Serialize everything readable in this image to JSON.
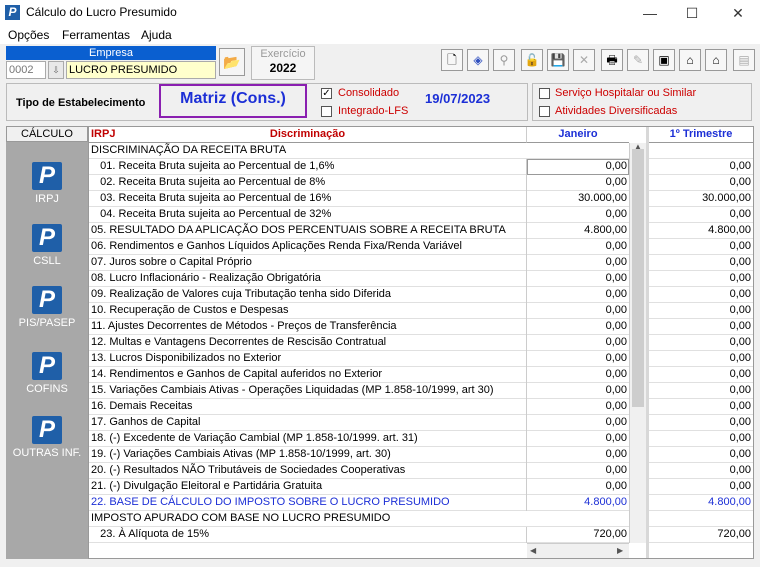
{
  "window": {
    "title": "Cálculo do Lucro Presumido",
    "minimize": "—",
    "maximize": "☐",
    "close": "✕"
  },
  "menu": [
    "Opções",
    "Ferramentas",
    "Ajuda"
  ],
  "empresa": {
    "label": "Empresa",
    "code": "0002",
    "name": "LUCRO PRESUMIDO"
  },
  "exercicio": {
    "label": "Exercício",
    "value": "2022"
  },
  "toolbar_icons": [
    "document-icon",
    "navigate-icon",
    "search-icon",
    "lock-icon",
    "save-icon",
    "delete-icon",
    "print-icon",
    "tools-icon",
    "export-icon",
    "import-icon",
    "import2-icon",
    "close-window-icon"
  ],
  "tipo": {
    "label": "Tipo de Estabelecimento",
    "value": "Matriz (Cons.)",
    "consolidado_label": "Consolidado",
    "integrado_label": "Integrado-LFS",
    "date": "19/07/2023",
    "servico_label": "Serviço Hospitalar ou Similar",
    "atividades_label": "Atividades Diversificadas"
  },
  "sidebar": {
    "header": "CÁLCULO",
    "items": [
      {
        "label": "IRPJ"
      },
      {
        "label": "CSLL"
      },
      {
        "label": "PIS/PASEP"
      },
      {
        "label": "COFINS"
      },
      {
        "label": "OUTRAS INF."
      }
    ]
  },
  "grid": {
    "col_tag": "IRPJ",
    "col_desc": "Discriminação",
    "col_jan": "Janeiro",
    "col_tri": "1º Trimestre",
    "rows": [
      {
        "desc": "DISCRIMINAÇÃO DA RECEITA BRUTA",
        "jan": "",
        "tri": "",
        "section": true
      },
      {
        "desc": "   01. Receita Bruta sujeita ao Percentual de 1,6%",
        "jan": "0,00",
        "tri": "0,00"
      },
      {
        "desc": "   02. Receita Bruta sujeita ao Percentual de 8%",
        "jan": "0,00",
        "tri": "0,00"
      },
      {
        "desc": "   03. Receita Bruta sujeita ao Percentual de 16%",
        "jan": "30.000,00",
        "tri": "30.000,00"
      },
      {
        "desc": "   04. Receita Bruta sujeita ao Percentual de 32%",
        "jan": "0,00",
        "tri": "0,00"
      },
      {
        "desc": "05. RESULTADO DA APLICAÇÃO DOS PERCENTUAIS SOBRE A RECEITA BRUTA",
        "jan": "4.800,00",
        "tri": "4.800,00"
      },
      {
        "desc": "06. Rendimentos e Ganhos Líquidos Aplicações Renda Fixa/Renda Variável",
        "jan": "0,00",
        "tri": "0,00"
      },
      {
        "desc": "07. Juros sobre o Capital Próprio",
        "jan": "0,00",
        "tri": "0,00"
      },
      {
        "desc": "08. Lucro Inflacionário - Realização Obrigatória",
        "jan": "0,00",
        "tri": "0,00"
      },
      {
        "desc": "09. Realização de Valores cuja Tributação tenha sido Diferida",
        "jan": "0,00",
        "tri": "0,00"
      },
      {
        "desc": "10. Recuperação de Custos e Despesas",
        "jan": "0,00",
        "tri": "0,00"
      },
      {
        "desc": "11. Ajustes Decorrentes de Métodos - Preços de Transferência",
        "jan": "0,00",
        "tri": "0,00"
      },
      {
        "desc": "12. Multas e Vantagens Decorrentes de Rescisão Contratual",
        "jan": "0,00",
        "tri": "0,00"
      },
      {
        "desc": "13. Lucros Disponibilizados no Exterior",
        "jan": "0,00",
        "tri": "0,00"
      },
      {
        "desc": "14. Rendimentos e Ganhos de Capital auferidos no Exterior",
        "jan": "0,00",
        "tri": "0,00"
      },
      {
        "desc": "15. Variações Cambiais Ativas - Operações Liquidadas (MP 1.858-10/1999, art 30)",
        "jan": "0,00",
        "tri": "0,00"
      },
      {
        "desc": "16. Demais Receitas",
        "jan": "0,00",
        "tri": "0,00"
      },
      {
        "desc": "17. Ganhos de Capital",
        "jan": "0,00",
        "tri": "0,00"
      },
      {
        "desc": "18. (-) Excedente de Variação Cambial (MP 1.858-10/1999. art. 31)",
        "jan": "0,00",
        "tri": "0,00"
      },
      {
        "desc": "19. (-) Variações Cambiais Ativas (MP 1.858-10/1999, art. 30)",
        "jan": "0,00",
        "tri": "0,00"
      },
      {
        "desc": "20. (-) Resultados NÃO Tributáveis de Sociedades Cooperativas",
        "jan": "0,00",
        "tri": "0,00"
      },
      {
        "desc": "21. (-) Divulgação Eleitoral e Partidária Gratuita",
        "jan": "0,00",
        "tri": "0,00"
      },
      {
        "desc": "22. BASE DE CÁLCULO DO IMPOSTO SOBRE O LUCRO PRESUMIDO",
        "jan": "4.800,00",
        "tri": "4.800,00",
        "blue": true
      },
      {
        "desc": "IMPOSTO APURADO COM BASE NO LUCRO PRESUMIDO",
        "jan": "",
        "tri": "",
        "section": true
      },
      {
        "desc": "   23. À Alíquota de 15%",
        "jan": "720,00",
        "tri": "720,00"
      }
    ]
  },
  "colors": {
    "accent": "#1c2fd6",
    "header_red": "#c00000",
    "matriz_border": "#8a1fb0",
    "sidebar_bg": "#a8a8a8",
    "empresa_bg": "#0a5fd0"
  }
}
